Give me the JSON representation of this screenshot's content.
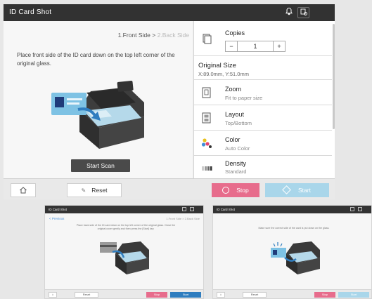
{
  "main": {
    "title": "ID Card Shot",
    "steps": {
      "step1": "1.Front Side",
      "sep": ">",
      "step2": "2.Back Side"
    },
    "instruction": "Place front side of the ID card down on the top left corner of the original glass.",
    "start_scan_label": "Start Scan",
    "settings": {
      "copies": {
        "label": "Copies",
        "value": "1",
        "minus": "−",
        "plus": "+"
      },
      "original_size": {
        "label": "Original Size",
        "value": "X:89.0mm, Y:51.0mm"
      },
      "zoom": {
        "label": "Zoom",
        "value": "Fit to paper size"
      },
      "layout": {
        "label": "Layout",
        "value": "Top/Bottom"
      },
      "color": {
        "label": "Color",
        "value": "Auto Color"
      },
      "density": {
        "label": "Density",
        "value": "Standard"
      }
    },
    "bottom": {
      "reset_label": "Reset",
      "stop_label": "Stop",
      "start_label": "Start"
    },
    "colors": {
      "title_bar": "#323232",
      "stop": "#e76c8c",
      "start": "#a9d6ea"
    }
  },
  "thumb1": {
    "title": "ID Card Shot",
    "previous_label": "< Previous",
    "steps": "1.Front Side > 2.Back Side",
    "instruction": "Place back side of the ID card down on the top left corner of the original glass. Close the original cover gently and then press the [Start] key.",
    "reset_label": "Reset",
    "stop_label": "Stop",
    "start_label": "Start"
  },
  "thumb2": {
    "title": "ID Card Shot",
    "instruction": "Make sure the correct side of the card is put down on the glass.",
    "reset_label": "Reset",
    "stop_label": "Stop",
    "start_label": "Start"
  }
}
